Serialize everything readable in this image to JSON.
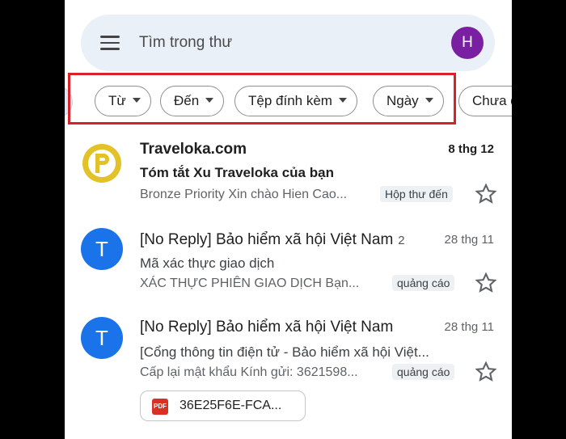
{
  "search": {
    "placeholder": "Tìm trong thư",
    "menu_icon": "menu-icon"
  },
  "account": {
    "initial": "H",
    "color": "#7b1fa2"
  },
  "filters": {
    "chips": [
      {
        "label": "Từ"
      },
      {
        "label": "Đến"
      },
      {
        "label": "Tệp đính kèm"
      },
      {
        "label": "Ngày"
      },
      {
        "label": "Chưa đ"
      }
    ],
    "highlight_color": "#d9212a"
  },
  "emails": [
    {
      "sender": "Traveloka.com",
      "date": "8 thg 12",
      "subject": "Tóm tắt Xu Traveloka của bạn",
      "snippet": "Bronze Priority Xin chào Hien Cao...",
      "label": "Hộp thư đến",
      "avatar_icon": "traveloka-logo-icon",
      "unread": true
    },
    {
      "sender": "[No Reply] Bảo hiểm xã hội Việt Nam",
      "count": "2",
      "date": "28 thg 11",
      "subject": "Mã xác thực giao dịch",
      "snippet": "XÁC THỰC PHIÊN GIAO DỊCH Bạn...",
      "label": "quảng cáo",
      "avatar": "T",
      "unread": false
    },
    {
      "sender": "[No Reply] Bảo hiểm xã hội Việt Nam",
      "date": "28 thg 11",
      "subject": "[Cổng thông tin điện tử - Bảo hiểm xã hội Việt...",
      "snippet": "Cấp lại mật khẩu Kính gửi: 3621598...",
      "label": "quảng cáo",
      "avatar": "T",
      "attachment": {
        "icon_text": "PDF",
        "name": "36E25F6E-FCA..."
      },
      "unread": false
    }
  ]
}
